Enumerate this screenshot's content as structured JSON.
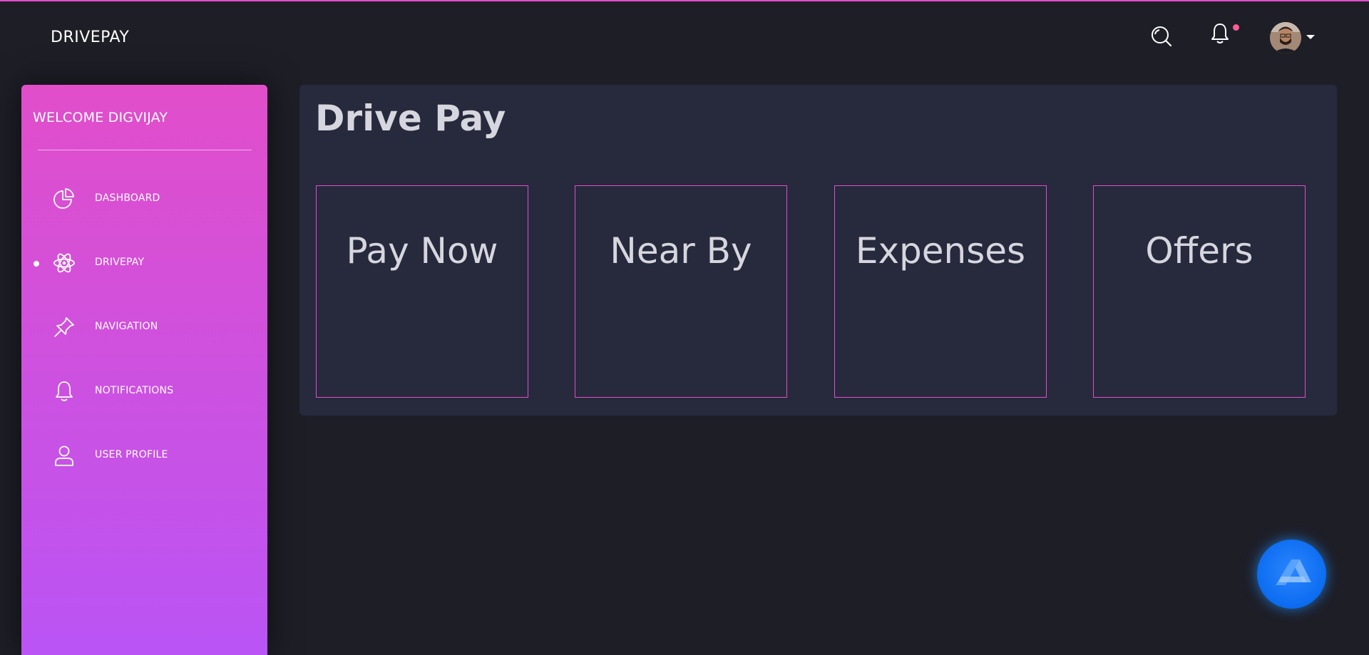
{
  "header": {
    "brand": "DRIVEPAY",
    "icons": [
      "search-icon",
      "bell-icon",
      "avatar",
      "chevron-down-icon"
    ],
    "notification_dot_color": "#fd5d93"
  },
  "sidebar": {
    "welcome": "WELCOME DIGVIJAY",
    "items": [
      {
        "label": "DASHBOARD",
        "icon": "pie-chart-icon",
        "active": false
      },
      {
        "label": "DRIVEPAY",
        "icon": "atom-icon",
        "active": true
      },
      {
        "label": "NAVIGATION",
        "icon": "pin-icon",
        "active": false
      },
      {
        "label": "NOTIFICATIONS",
        "icon": "bell-icon",
        "active": false
      },
      {
        "label": "USER PROFILE",
        "icon": "user-icon",
        "active": false
      }
    ],
    "gradient": [
      "#e14eca",
      "#ba54f5"
    ]
  },
  "main": {
    "title": "Drive Pay",
    "cards": [
      {
        "label": "Pay Now"
      },
      {
        "label": "Near By"
      },
      {
        "label": "Expenses"
      },
      {
        "label": "Offers"
      }
    ],
    "card_border_color": "#e14eca"
  },
  "fab": {
    "icon": "app-logo-icon",
    "color": "#1d8cf8"
  }
}
